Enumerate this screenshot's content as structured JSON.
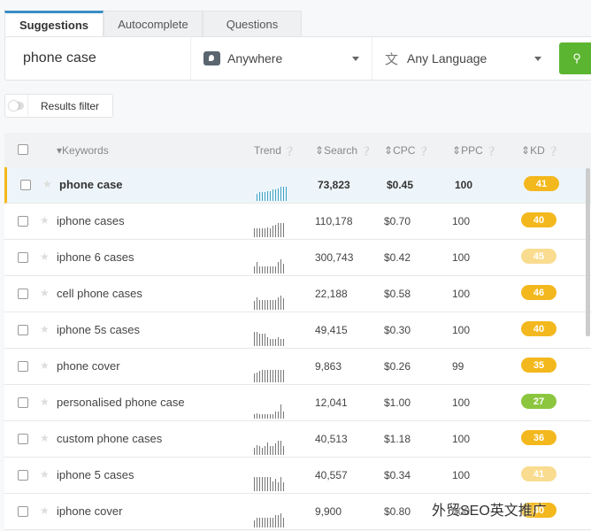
{
  "tabs": [
    {
      "label": "Suggestions"
    },
    {
      "label": "Autocomplete"
    },
    {
      "label": "Questions"
    }
  ],
  "search": {
    "query": "phone case",
    "location": "Anywhere",
    "language": "Any Language",
    "location_icon": "location-pin-icon",
    "language_icon": "translate-icon",
    "button_icon": "search-icon"
  },
  "filter": {
    "label": "Results filter",
    "enabled": false
  },
  "table": {
    "headers": {
      "keywords": "Keywords",
      "trend": "Trend",
      "search": "Search",
      "cpc": "CPC",
      "ppc": "PPC",
      "kd": "KD"
    },
    "rows": [
      {
        "keyword": "phone case",
        "search": "73,823",
        "cpc": "$0.45",
        "ppc": "100",
        "kd": "41",
        "kd_color": "#f3b81d",
        "trend": [
          5,
          6,
          6,
          6,
          7,
          7,
          8,
          8,
          9,
          10,
          10,
          10
        ],
        "selected": true
      },
      {
        "keyword": "iphone cases",
        "search": "110,178",
        "cpc": "$0.70",
        "ppc": "100",
        "kd": "40",
        "kd_color": "#f3b81d",
        "trend": [
          6,
          6,
          6,
          6,
          6,
          7,
          6,
          8,
          9,
          10,
          10,
          10
        ]
      },
      {
        "keyword": "iphone 6 cases",
        "search": "300,743",
        "cpc": "$0.42",
        "ppc": "100",
        "kd": "45",
        "kd_color": "#f9dc8f",
        "trend": [
          5,
          8,
          5,
          5,
          5,
          5,
          5,
          5,
          5,
          8,
          10,
          7
        ]
      },
      {
        "keyword": "cell phone cases",
        "search": "22,188",
        "cpc": "$0.58",
        "ppc": "100",
        "kd": "46",
        "kd_color": "#f3b81d",
        "trend": [
          6,
          9,
          7,
          7,
          7,
          7,
          7,
          7,
          7,
          9,
          10,
          8
        ]
      },
      {
        "keyword": "iphone 5s cases",
        "search": "49,415",
        "cpc": "$0.30",
        "ppc": "100",
        "kd": "40",
        "kd_color": "#f3b81d",
        "trend": [
          10,
          10,
          9,
          9,
          9,
          6,
          5,
          5,
          5,
          6,
          5,
          5
        ]
      },
      {
        "keyword": "phone cover",
        "search": "9,863",
        "cpc": "$0.26",
        "ppc": "99",
        "kd": "35",
        "kd_color": "#f3b81d",
        "trend": [
          6,
          7,
          8,
          9,
          9,
          9,
          9,
          9,
          9,
          9,
          9,
          9
        ]
      },
      {
        "keyword": "personalised phone case",
        "search": "12,041",
        "cpc": "$1.00",
        "ppc": "100",
        "kd": "27",
        "kd_color": "#8cc63f",
        "trend": [
          3,
          4,
          3,
          3,
          3,
          3,
          3,
          3,
          5,
          5,
          10,
          5
        ]
      },
      {
        "keyword": "custom phone cases",
        "search": "40,513",
        "cpc": "$1.18",
        "ppc": "100",
        "kd": "36",
        "kd_color": "#f3b81d",
        "trend": [
          5,
          7,
          6,
          5,
          6,
          9,
          6,
          6,
          8,
          10,
          10,
          6
        ]
      },
      {
        "keyword": "iphone 5 cases",
        "search": "40,557",
        "cpc": "$0.34",
        "ppc": "100",
        "kd": "41",
        "kd_color": "#f9dc8f",
        "trend": [
          10,
          10,
          10,
          10,
          10,
          10,
          10,
          7,
          9,
          6,
          10,
          6
        ]
      },
      {
        "keyword": "iphone cover",
        "search": "9,900",
        "cpc": "$0.80",
        "ppc": "100",
        "kd": "40",
        "kd_color": "#f3b81d",
        "trend": [
          5,
          7,
          7,
          7,
          7,
          7,
          7,
          7,
          9,
          9,
          10,
          7
        ]
      }
    ]
  },
  "watermark": "外贸SEO英文推广"
}
